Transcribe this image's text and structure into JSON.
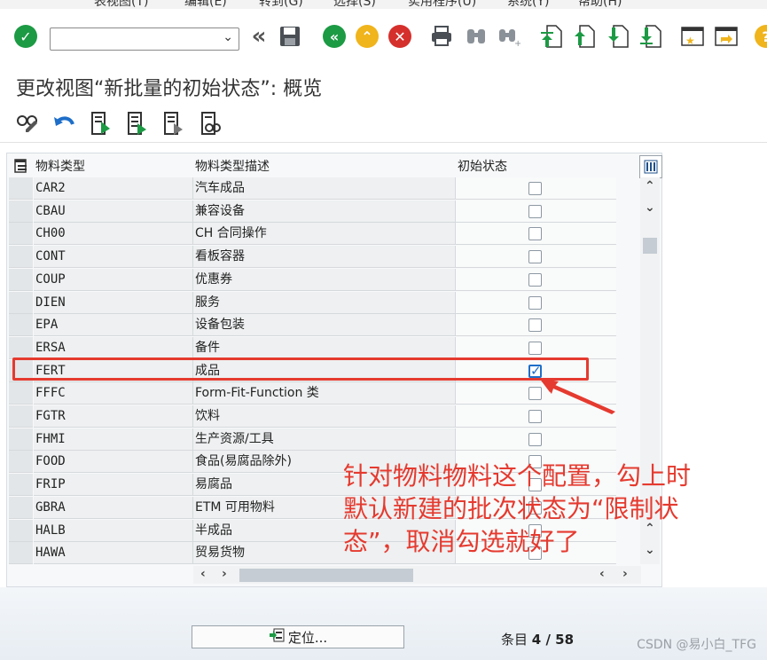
{
  "menubar": [
    "表视图(T)",
    "编辑(E)",
    "转到(G)",
    "选择(S)",
    "实用程序(U)",
    "系统(Y)",
    "帮助(H)"
  ],
  "title": "更改视图“新批量的初始状态”: 概览",
  "columns": [
    "物料类型",
    "物料类型描述",
    "初始状态"
  ],
  "rows": [
    {
      "code": "CAR2",
      "desc": "汽车成品",
      "checked": false
    },
    {
      "code": "CBAU",
      "desc": "兼容设备",
      "checked": false
    },
    {
      "code": "CH00",
      "desc": "CH 合同操作",
      "checked": false
    },
    {
      "code": "CONT",
      "desc": "看板容器",
      "checked": false
    },
    {
      "code": "COUP",
      "desc": "优惠券",
      "checked": false
    },
    {
      "code": "DIEN",
      "desc": "服务",
      "checked": false
    },
    {
      "code": "EPA",
      "desc": "设备包装",
      "checked": false
    },
    {
      "code": "ERSA",
      "desc": "备件",
      "checked": false
    },
    {
      "code": "FERT",
      "desc": "成品",
      "checked": true
    },
    {
      "code": "FFFC",
      "desc": "Form-Fit-Function 类",
      "checked": false
    },
    {
      "code": "FGTR",
      "desc": "饮料",
      "checked": false
    },
    {
      "code": "FHMI",
      "desc": "生产资源/工具",
      "checked": false
    },
    {
      "code": "FOOD",
      "desc": "食品(易腐品除外)",
      "checked": false
    },
    {
      "code": "FRIP",
      "desc": "易腐品",
      "checked": false
    },
    {
      "code": "GBRA",
      "desc": "ETM 可用物料",
      "checked": false
    },
    {
      "code": "HALB",
      "desc": "半成品",
      "checked": false
    },
    {
      "code": "HAWA",
      "desc": "贸易货物",
      "checked": false
    }
  ],
  "annotation": [
    "针对物料物料这个配置，勾上时",
    "默认新建的批次状态为“限制状",
    "态”，取消勾选就好了"
  ],
  "position_button": "定位...",
  "entry_label": "条目",
  "entry_value": "4 / 58",
  "watermark": "CSDN @易小白_TFG",
  "colors": {
    "accent_red": "#e53a2f",
    "check_blue": "#1d6ec9",
    "nav_green": "#1c9a44",
    "exit_yellow": "#f0b41c",
    "cancel_red": "#d5302c"
  }
}
